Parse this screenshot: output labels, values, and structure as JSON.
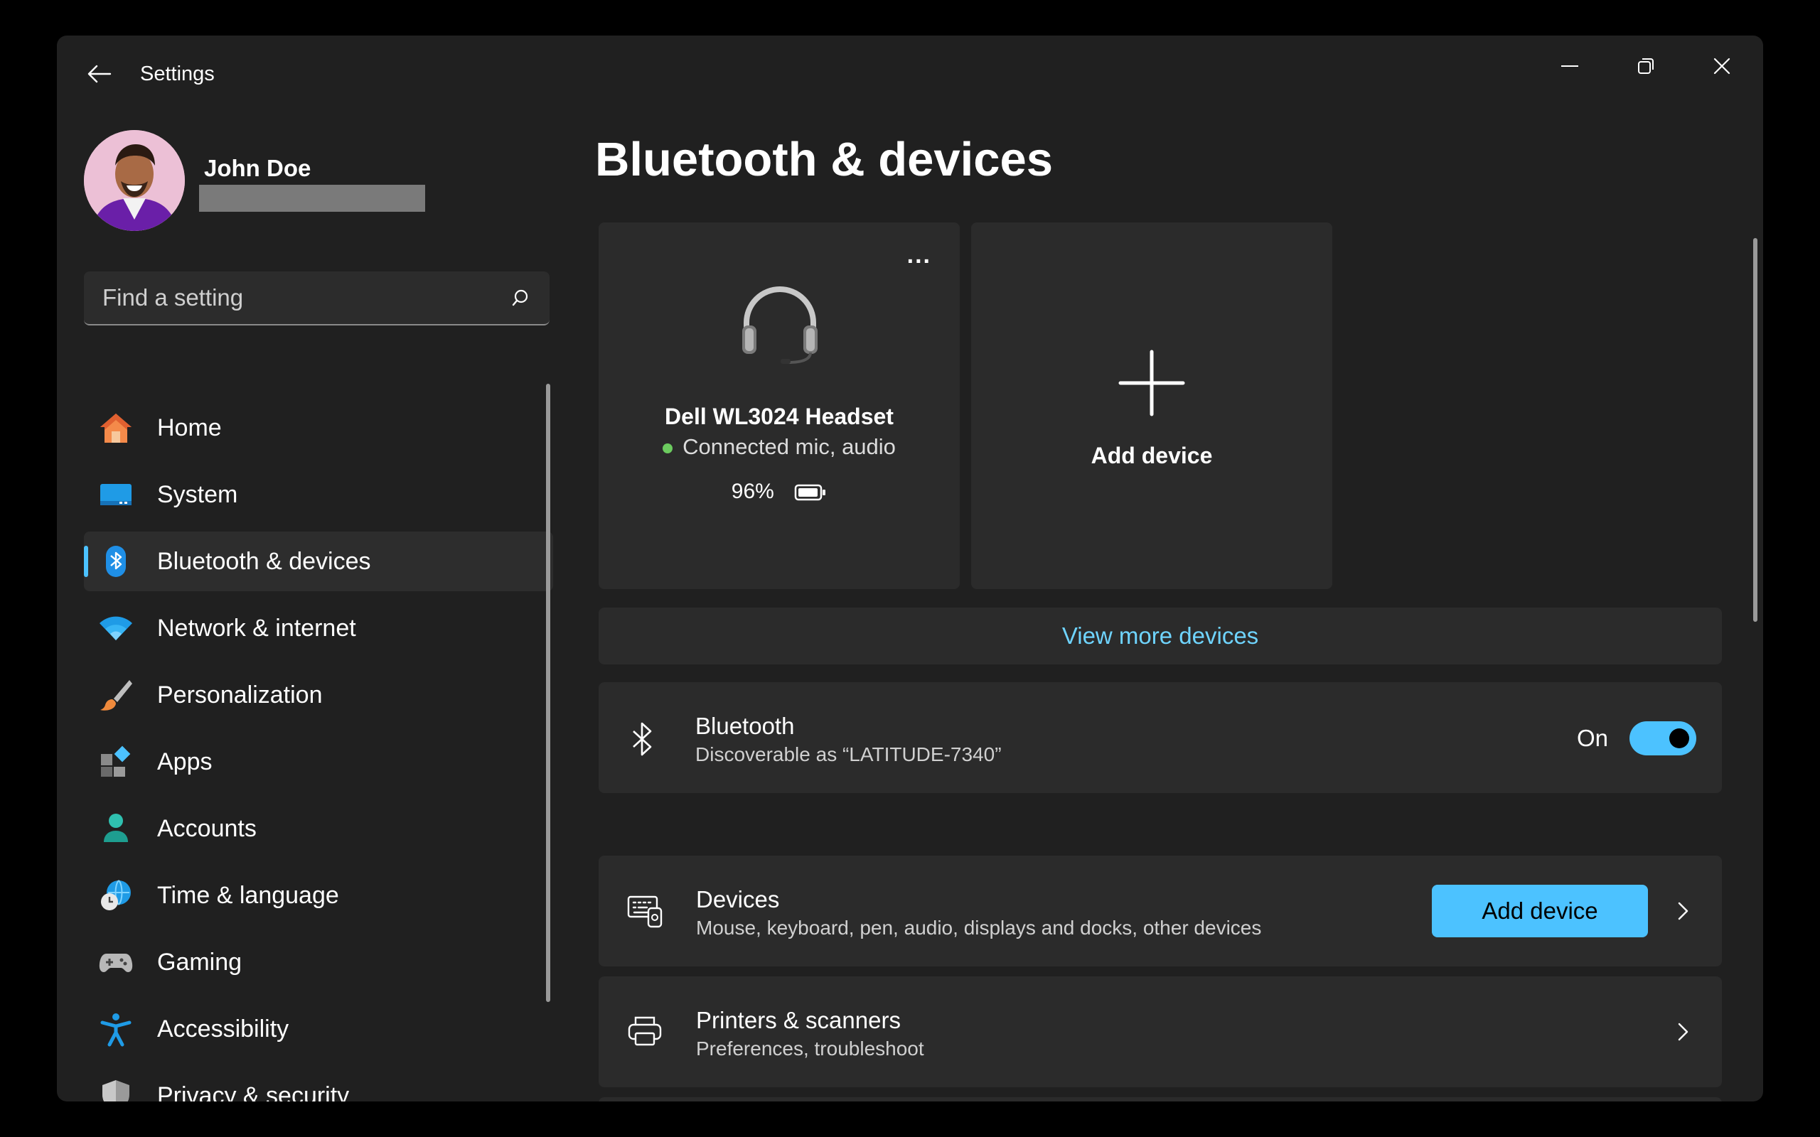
{
  "window": {
    "title": "Settings"
  },
  "user": {
    "name": "John Doe"
  },
  "search": {
    "placeholder": "Find a setting"
  },
  "nav": {
    "items": [
      {
        "label": "Home",
        "icon": "home-icon"
      },
      {
        "label": "System",
        "icon": "system-icon"
      },
      {
        "label": "Bluetooth & devices",
        "icon": "bluetooth-icon",
        "active": true
      },
      {
        "label": "Network & internet",
        "icon": "wifi-icon"
      },
      {
        "label": "Personalization",
        "icon": "brush-icon"
      },
      {
        "label": "Apps",
        "icon": "apps-icon"
      },
      {
        "label": "Accounts",
        "icon": "person-icon"
      },
      {
        "label": "Time & language",
        "icon": "clock-globe-icon"
      },
      {
        "label": "Gaming",
        "icon": "gamepad-icon"
      },
      {
        "label": "Accessibility",
        "icon": "accessibility-icon"
      },
      {
        "label": "Privacy & security",
        "icon": "shield-icon"
      }
    ]
  },
  "page": {
    "title": "Bluetooth & devices"
  },
  "device_card": {
    "name": "Dell WL3024 Headset",
    "status": "Connected mic, audio",
    "battery": "96%",
    "more_label": "..."
  },
  "add_card": {
    "label": "Add device"
  },
  "view_more": {
    "label": "View more devices"
  },
  "bluetooth": {
    "title": "Bluetooth",
    "subtitle": "Discoverable as “LATITUDE-7340”",
    "state_label": "On",
    "enabled": true
  },
  "devices_row": {
    "title": "Devices",
    "subtitle": "Mouse, keyboard, pen, audio, displays and docks, other devices",
    "button_label": "Add device"
  },
  "printers_row": {
    "title": "Printers & scanners",
    "subtitle": "Preferences, troubleshoot"
  },
  "colors": {
    "accent": "#4cc2ff",
    "window_bg": "#202020",
    "card_bg": "#2b2b2b",
    "status_green": "#6ccb5f"
  }
}
